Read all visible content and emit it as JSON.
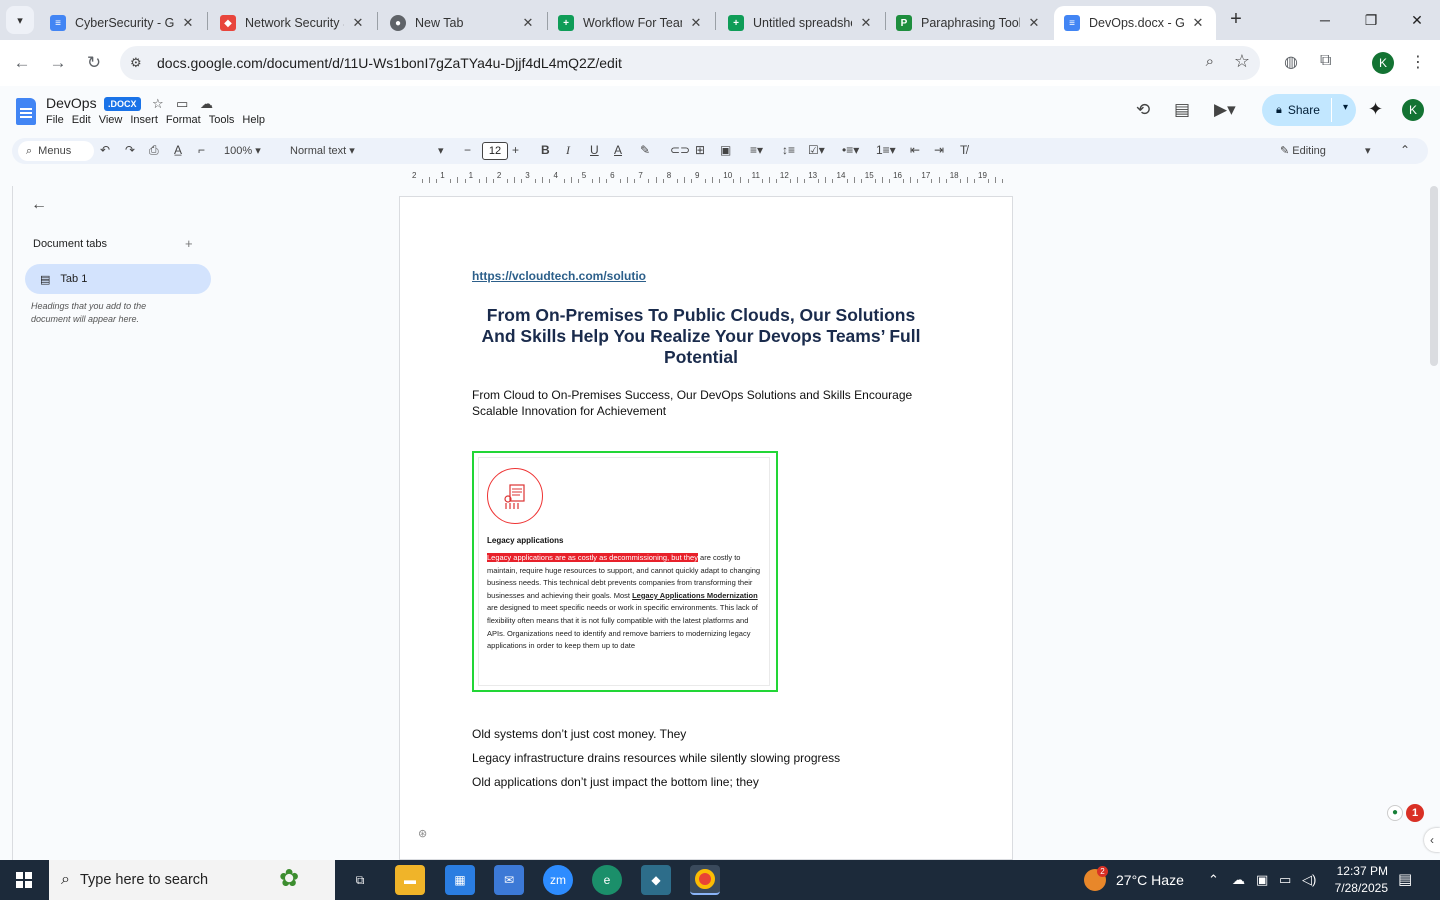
{
  "browser": {
    "tabs": [
      {
        "title": "CyberSecurity - Go",
        "favicon": "docs-icon",
        "color": "#4285f4"
      },
      {
        "title": "Network Security S",
        "favicon": "gem-icon",
        "color": "#e8453c"
      },
      {
        "title": "New Tab",
        "favicon": "chrome-icon",
        "color": "#5f6368"
      },
      {
        "title": "Workflow For Team",
        "favicon": "sheets-icon",
        "color": "#0f9d58"
      },
      {
        "title": "Untitled spreadshe",
        "favicon": "sheets-icon",
        "color": "#0f9d58"
      },
      {
        "title": "Paraphrasing Tool",
        "favicon": "paraphrase-icon",
        "color": "#1e8e3e"
      },
      {
        "title": "DevOps.docx - Go",
        "favicon": "docs-icon",
        "color": "#4285f4"
      }
    ],
    "url": "docs.google.com/document/d/11U-Ws1bonI7gZaTYa4u-Djjf4dL4mQ2Z/edit",
    "profile_initial": "K"
  },
  "docs": {
    "title": "DevOps",
    "badge": ".DOCX",
    "menu": [
      "File",
      "Edit",
      "View",
      "Insert",
      "Format",
      "Tools",
      "Help"
    ],
    "share_label": "Share",
    "avatar_initial": "K"
  },
  "toolbar": {
    "menus_label": "Menus",
    "zoom": "100%",
    "style": "Normal text",
    "font_size": "12",
    "mode": "Editing"
  },
  "ruler": {
    "labels": [
      "2",
      "1",
      "1",
      "2",
      "3",
      "4",
      "5",
      "6",
      "7",
      "8",
      "9",
      "10",
      "11",
      "12",
      "13",
      "14",
      "15",
      "16",
      "17",
      "18",
      "19"
    ]
  },
  "sidebar": {
    "section_label": "Document tabs",
    "tab_label": "Tab 1",
    "hint": "Headings that you add to the document will appear here."
  },
  "document": {
    "link": "https://vcloudtech.com/solutio",
    "heading": "From On-Premises To Public Clouds, Our Solutions And Skills Help You Realize Your Devops Teams’ Full Potential",
    "subheading": "From Cloud to On-Premises Success, Our DevOps Solutions and Skills Encourage Scalable Innovation for Achievement",
    "image": {
      "title": "Legacy applications",
      "highlight": "Legacy applications are as costly as decommissioning, but they",
      "text_a": " are costly to maintain, require huge resources to support, and cannot quickly adapt to changing business needs. This technical debt prevents companies from transforming their businesses and achieving their goals. Most ",
      "bold_link": "Legacy Applications Modernization",
      "text_b": " are designed to meet specific needs or work in specific environments. This lack of flexibility often means that it is not fully compatible with the latest platforms and APIs. Organizations need to identify and remove barriers to modernizing legacy applications in order to keep them up to date"
    },
    "lines": [
      "Old systems don’t just cost money. They",
      "Legacy infrastructure drains resources while silently slowing progress",
      "Old applications don’t just impact the bottom line; they"
    ]
  },
  "notifications": {
    "count": "1"
  },
  "taskbar": {
    "search_placeholder": "Type here to search",
    "weather": "27°C  Haze",
    "weather_badge": "2",
    "time": "12:37 PM",
    "date": "7/28/2025"
  }
}
